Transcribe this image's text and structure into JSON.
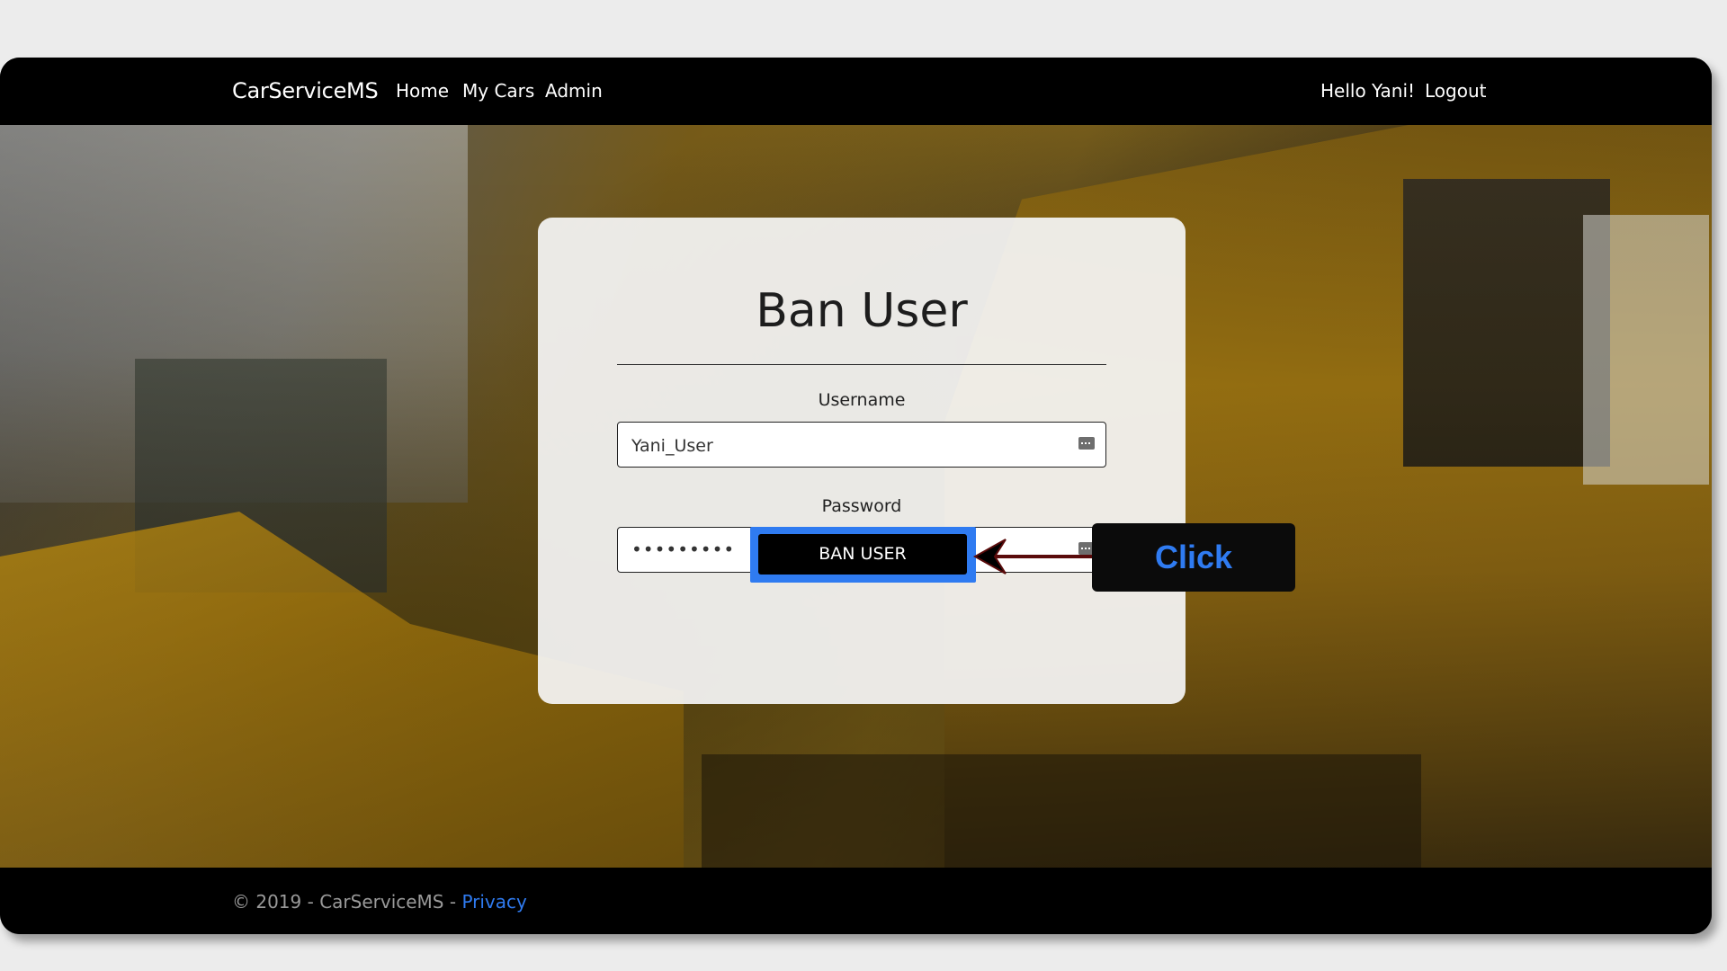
{
  "navbar": {
    "brand": "CarServiceMS",
    "links": [
      "Home",
      "My Cars",
      "Admin"
    ],
    "greeting": "Hello Yani!",
    "logout": "Logout"
  },
  "form": {
    "title": "Ban User",
    "username_label": "Username",
    "username_value": "Yani_User",
    "password_label": "Password",
    "password_value": "•••••••••",
    "submit_label": "BAN USER"
  },
  "annotation": {
    "callout_text": "Click",
    "accent_color": "#2f7bf1",
    "arrow_color": "#5a0b0b"
  },
  "footer": {
    "copyright": "© 2019 - CarServiceMS - ",
    "privacy_link": "Privacy"
  }
}
